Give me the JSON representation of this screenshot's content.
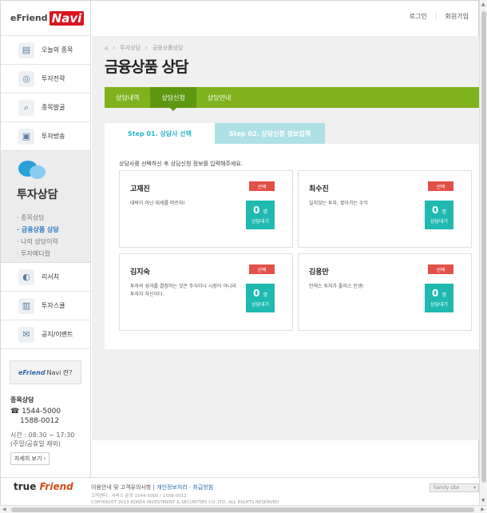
{
  "logo": {
    "prefix": "eFriend",
    "suffix": "Navi"
  },
  "toplinks": {
    "login": "로그인",
    "signup": "회원가입"
  },
  "sidebar": {
    "items_top": [
      {
        "label": "오늘의 종목",
        "icon": "newspaper-icon",
        "glyph": "▤"
      },
      {
        "label": "투자전략",
        "icon": "target-icon",
        "glyph": "◎"
      },
      {
        "label": "종목발굴",
        "icon": "magnifier-icon",
        "glyph": "⌕"
      },
      {
        "label": "투자방송",
        "icon": "tv-icon",
        "glyph": "▣"
      }
    ],
    "active": {
      "title": "투자상담",
      "submenu": [
        "종목상담",
        "금융상품 상담",
        "나의 상담이력",
        "투자메디컬"
      ],
      "selected_index": 1
    },
    "items_bottom": [
      {
        "label": "리서치",
        "icon": "research-icon",
        "glyph": "◐"
      },
      {
        "label": "투자스쿨",
        "icon": "book-icon",
        "glyph": "▥"
      },
      {
        "label": "공지/이벤트",
        "icon": "gift-icon",
        "glyph": "✉"
      }
    ],
    "promo": {
      "brand": "eFriend",
      "text": "Navi 란?"
    },
    "contact": {
      "title": "종목상담",
      "phone1": "☎ 1544-5000",
      "phone2": "1588-0012",
      "hours": "시간 : 08:30 ~ 17:30",
      "holiday": "(주말/공휴일 제외)",
      "more": "자세히 보기 ›"
    }
  },
  "breadcrumb": [
    "⌂",
    "투자상담",
    "금융상품상담"
  ],
  "page_title": "금융상품 상담",
  "tabs": [
    "상담내역",
    "상담신청",
    "상담안내"
  ],
  "active_tab": 1,
  "steps": [
    "Step 01. 상담사 선택",
    "Step 02. 상담신청 정보입력"
  ],
  "instruction": "상담사를 선택하신 후 상담신청 정보를 입력해주세요.",
  "consultants": [
    {
      "name": "고재진",
      "desc": "대박이 아닌 대세를 따르자!",
      "select": "선택",
      "count": "0",
      "unit": "명",
      "wait_label": "상담대기"
    },
    {
      "name": "최수진",
      "desc": "일지않는 투자, 쌓아가는 수익",
      "select": "선택",
      "count": "0",
      "unit": "명",
      "wait_label": "상담대기"
    },
    {
      "name": "김지숙",
      "desc": "투자의 성과를 결정하는 것은 주식이나 시장이 아니라 투자자 자신이다.",
      "select": "선택",
      "count": "0",
      "unit": "명",
      "wait_label": "상담대기"
    },
    {
      "name": "김용만",
      "desc": "인덱스 투자가 좋러스 인생!",
      "select": "선택",
      "count": "0",
      "unit": "명",
      "wait_label": "상담대기"
    }
  ],
  "footer": {
    "logo_a": "true",
    "logo_b": "Friend",
    "link1": "이용안내 및 고객유의사항",
    "sep": "|",
    "link2": "개인정보처리 · 취급방침",
    "small1": "고객센터 : 서비스 문의 1544-5000 / 1588-0012",
    "small2": "COPYRIGHT 2013 KOREA INVESTMENT & SECURITIES CO.,LTD. ALL RIGHTS RESERVED",
    "family": "Family site"
  },
  "colors": {
    "tab_green": "#7fb21c",
    "step_teal": "#2ab5c8",
    "select_red": "#e2504a",
    "wait_teal": "#1fb9b0"
  }
}
